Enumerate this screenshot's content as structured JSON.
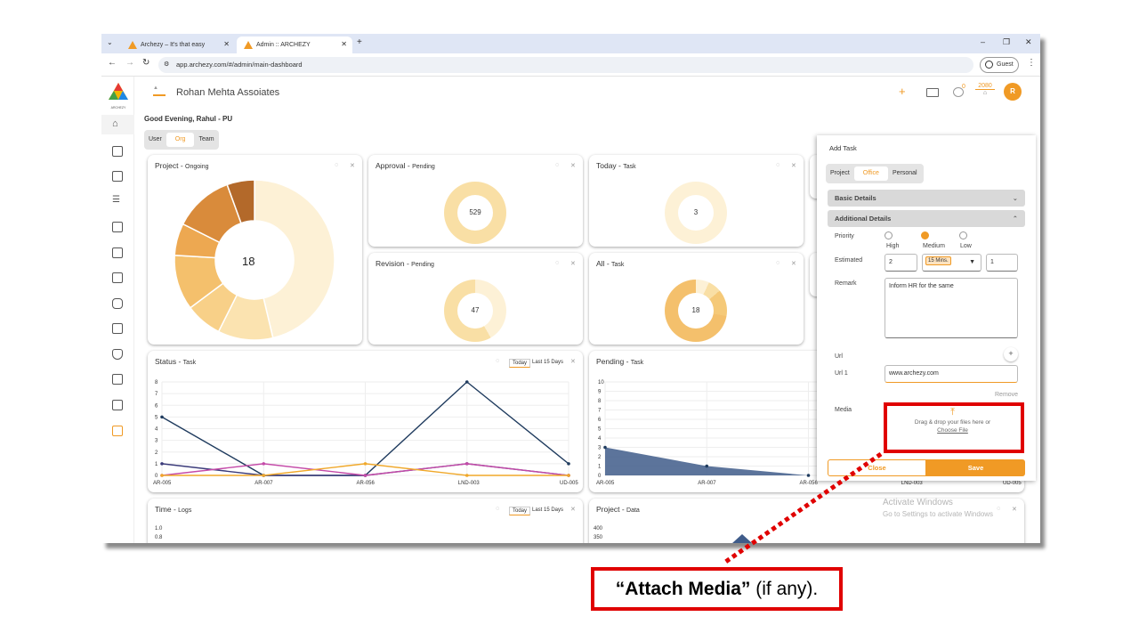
{
  "browser": {
    "tabs": [
      {
        "title": "Archezy – It's that easy"
      },
      {
        "title": "Admin :: ARCHEZY"
      }
    ],
    "url": "app.archezy.com/#/admin/main-dashboard",
    "profile": "Guest"
  },
  "header": {
    "org_name": "Rohan Mehta Assoiates",
    "logo_text": "ARCHEZY",
    "points": "2080",
    "notif_count": "0",
    "avatar_letter": "R",
    "add_icon": "+"
  },
  "greeting": "Good Evening, Rahul - PU",
  "scope_tabs": [
    "User",
    "Org",
    "Team"
  ],
  "cards": {
    "project": {
      "title": "Project",
      "sub": "Ongoing",
      "center": "18"
    },
    "approval": {
      "title": "Approval",
      "sub": "Pending",
      "center": "529"
    },
    "today": {
      "title": "Today",
      "sub": "Task",
      "center": "3"
    },
    "revision": {
      "title": "Revision",
      "sub": "Pending",
      "center": "47"
    },
    "all": {
      "title": "All",
      "sub": "Task",
      "center": "18"
    },
    "status": {
      "title": "Status",
      "sub": "Task",
      "btn_today": "Today",
      "btn_last": "Last 15 Days"
    },
    "pending": {
      "title": "Pending",
      "sub": "Task"
    },
    "time": {
      "title": "Time",
      "sub": "Logs",
      "btn_today": "Today",
      "btn_last": "Last 15 Days"
    },
    "projdata": {
      "title": "Project",
      "sub": "Data"
    }
  },
  "chart_data": [
    {
      "type": "pie",
      "title": "Project - Ongoing",
      "values": [
        50,
        12,
        8,
        12,
        7,
        13,
        6
      ],
      "colors": [
        "#fdf1d6",
        "#fbe3b0",
        "#f8d088",
        "#f4c06c",
        "#eda851",
        "#d98b3b",
        "#b3692a"
      ]
    },
    {
      "type": "line",
      "title": "Status - Task",
      "categories": [
        "AR-005",
        "AR-007",
        "AR-056",
        "LND-003",
        "UD-005"
      ],
      "ylim": [
        0,
        8
      ],
      "yticks": [
        "0",
        "1",
        "2",
        "3",
        "4",
        "5",
        "6",
        "7",
        "8"
      ],
      "series": [
        {
          "values": [
            5,
            0,
            0,
            8,
            1
          ],
          "color": "#1f3b5e"
        },
        {
          "values": [
            1,
            0,
            0,
            1,
            0
          ],
          "color": "#3b3b7a"
        },
        {
          "values": [
            0,
            1,
            0,
            1,
            0
          ],
          "color": "#c44aa8"
        },
        {
          "values": [
            0,
            0,
            1,
            0,
            0
          ],
          "color": "#f0a82a"
        }
      ]
    },
    {
      "type": "area",
      "title": "Pending - Task",
      "categories": [
        "AR-005",
        "AR-007",
        "AR-056",
        "LND-003",
        "UD-005"
      ],
      "ylim": [
        0,
        10
      ],
      "yticks": [
        "0",
        "1",
        "2",
        "3",
        "4",
        "5",
        "6",
        "7",
        "8",
        "9",
        "10"
      ],
      "series": [
        {
          "values": [
            3,
            1,
            0
          ],
          "color": "#3f5c8a"
        }
      ]
    },
    {
      "type": "line",
      "title": "Time - Logs",
      "yticks": [
        "1.0",
        "0.8"
      ]
    },
    {
      "type": "area",
      "title": "Project - Data",
      "yticks": [
        "400",
        "350"
      ]
    }
  ],
  "add_task": {
    "title": "Add Task",
    "types": [
      "Project",
      "Office",
      "Personal"
    ],
    "basic_details": "Basic Details",
    "additional_details": "Additional Details",
    "priority_label": "Priority",
    "priorities": [
      "High",
      "Medium",
      "Low"
    ],
    "estimated_label": "Estimated",
    "est_value": "2",
    "est_unit": "15 Mins.",
    "est_count": "1",
    "remark_label": "Remark",
    "remark_value": "Inform HR for the same",
    "url_label": "Url",
    "url1_label": "Url 1",
    "url1_value": "www.archezy.com",
    "remove": "Remove",
    "media_label": "Media",
    "drop_text": "Drag & drop your files here or",
    "choose_file": "Choose File",
    "close": "Close",
    "save": "Save"
  },
  "watermark": {
    "line1": "Activate Windows",
    "line2": "Go to Settings to activate Windows"
  },
  "callout": {
    "bold": "“Attach Media”",
    "rest": " (if any)."
  }
}
